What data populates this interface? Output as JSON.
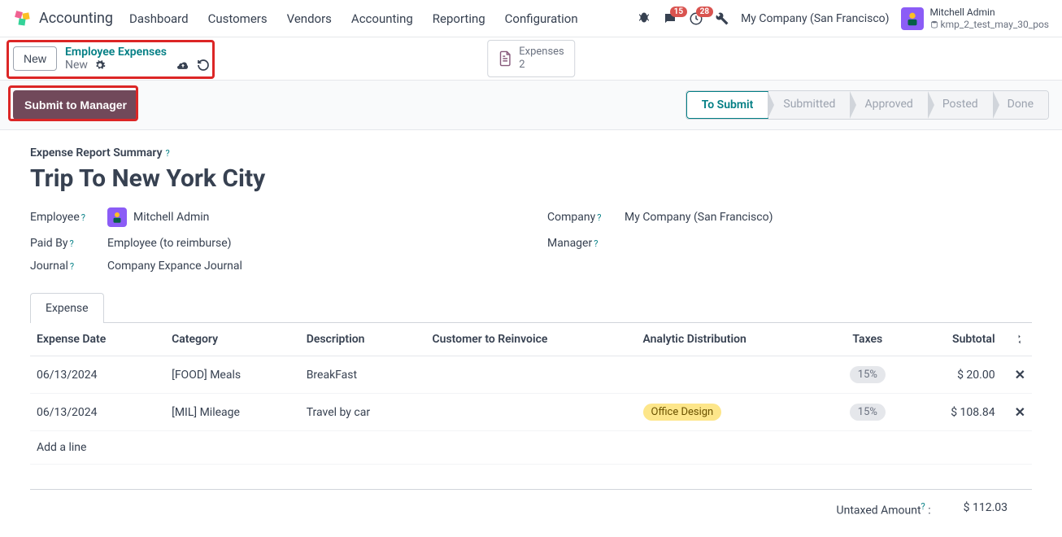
{
  "navbar": {
    "app_name": "Accounting",
    "menu": [
      "Dashboard",
      "Customers",
      "Vendors",
      "Accounting",
      "Reporting",
      "Configuration"
    ],
    "messages_badge": "15",
    "activities_badge": "28",
    "company": "My Company (San Francisco)",
    "user_name": "Mitchell Admin",
    "user_db": "kmp_2_test_may_30_pos"
  },
  "breadcrumb": {
    "new_btn": "New",
    "link": "Employee Expenses",
    "current": "New",
    "stat_label": "Expenses",
    "stat_count": "2"
  },
  "actions": {
    "submit": "Submit to Manager",
    "statuses": [
      "To Submit",
      "Submitted",
      "Approved",
      "Posted",
      "Done"
    ]
  },
  "form": {
    "summary_label": "Expense Report Summary",
    "title": "Trip To New York City",
    "employee_label": "Employee",
    "employee_value": "Mitchell Admin",
    "company_label": "Company",
    "company_value": "My Company (San Francisco)",
    "paid_by_label": "Paid By",
    "paid_by_value": "Employee (to reimburse)",
    "manager_label": "Manager",
    "manager_value": "",
    "journal_label": "Journal",
    "journal_value": "Company Expance Journal"
  },
  "tab": {
    "expense": "Expense"
  },
  "table": {
    "headers": {
      "date": "Expense Date",
      "category": "Category",
      "description": "Description",
      "customer": "Customer to Reinvoice",
      "analytic": "Analytic Distribution",
      "taxes": "Taxes",
      "subtotal": "Subtotal"
    },
    "rows": [
      {
        "date": "06/13/2024",
        "category": "[FOOD] Meals",
        "description": "BreakFast",
        "analytic": "",
        "tax": "15%",
        "subtotal": "$ 20.00"
      },
      {
        "date": "06/13/2024",
        "category": "[MIL] Mileage",
        "description": "Travel by car",
        "analytic": "Office Design",
        "tax": "15%",
        "subtotal": "$ 108.84"
      }
    ],
    "add_line": "Add a line"
  },
  "totals": {
    "untaxed_label": "Untaxed Amount",
    "untaxed_value": "$ 112.03"
  }
}
